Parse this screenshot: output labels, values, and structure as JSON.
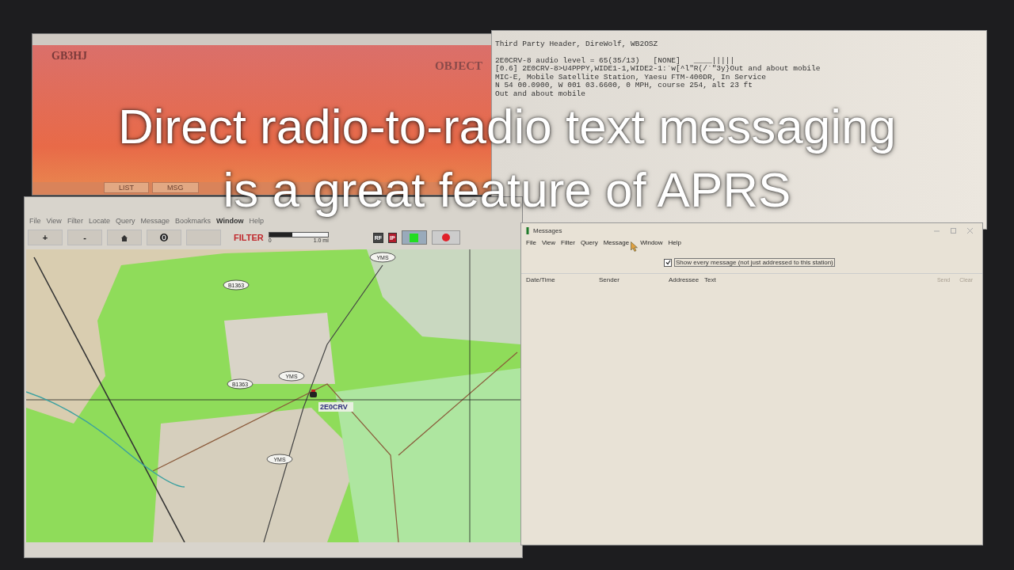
{
  "object_window": {
    "callsign": "GB3HJ",
    "type_label": "OBJECT",
    "buttons": [
      "LIST",
      "MSG"
    ]
  },
  "terminal": {
    "lines": [
      "Third Party Header, DireWolf, WB2OSZ",
      "2E0CRV-8 audio level = 65(35/13)   [NONE]   ____|||||",
      "[0.6] 2E0CRV-8>U4PPPY,WIDE1-1,WIDE2-1:`w[^l\"R(/`\"3y}Out and about mobile",
      "MIC-E, Mobile Satellite Station, Yaesu FTM-400DR, In Service",
      "N 54 00.0900, W 001 03.6600, 0 MPH, course 254, alt 23 ft",
      "Out and about mobile"
    ]
  },
  "map_window": {
    "menu": [
      {
        "label": "File",
        "active": false
      },
      {
        "label": "View",
        "active": false
      },
      {
        "label": "Filter",
        "active": false
      },
      {
        "label": "Locate",
        "active": false
      },
      {
        "label": "Query",
        "active": false
      },
      {
        "label": "Message",
        "active": false
      },
      {
        "label": "Bookmarks",
        "active": false
      },
      {
        "label": "Window",
        "active": true
      },
      {
        "label": "Help",
        "active": false
      }
    ],
    "toolbar": {
      "zoom_buttons": [
        "+",
        "-"
      ],
      "filter_label": "FILTER",
      "range": {
        "level": 0.4,
        "min_label": "0",
        "max_label": "1.0 mi"
      },
      "badges": [
        "RF",
        "IP"
      ]
    },
    "map": {
      "road_labels": [
        "B1363",
        "B1363",
        "YMS",
        "YMS",
        "YMS"
      ],
      "station": "2E0CRV"
    }
  },
  "messages_window": {
    "title": "Messages",
    "menu": [
      "File",
      "View",
      "Filter",
      "Query",
      "Message",
      "Window",
      "Help"
    ],
    "show_all": {
      "label": "Show every message (not just addressed to this station)",
      "checked": true
    },
    "columns": [
      "Date/Time",
      "Sender",
      "Addressee",
      "Text"
    ],
    "buttons": [
      {
        "label": "Send",
        "disabled": true
      },
      {
        "label": "Clear",
        "disabled": true
      }
    ]
  },
  "caption": [
    "Direct radio-to-radio text messaging",
    "is a great feature of APRS"
  ]
}
